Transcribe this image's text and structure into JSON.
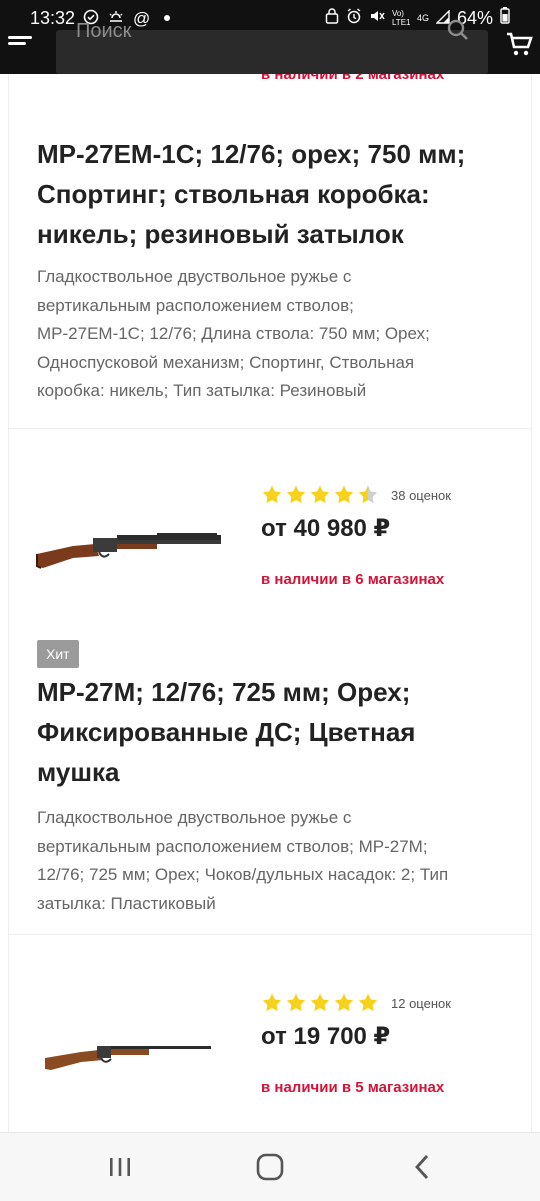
{
  "status_bar": {
    "time": "13:32",
    "battery": "64%",
    "network_label": "Vo) LTE1",
    "signal_label": "4G"
  },
  "header": {
    "search_placeholder": "Поиск",
    "accent_color": "#d2143a"
  },
  "products": [
    {
      "availability": "в наличии в 2 магазинах",
      "title_lines": [
        "МР-27ЕМ-1С; 12/76; орех; 750 мм;",
        "Спортинг; ствольная коробка:",
        "никель; резиновый затылок"
      ],
      "description_lines": [
        "Гладкоствольное двуствольное ружье с",
        "вертикальным расположением стволов;",
        "МР-27ЕМ-1С; 12/76; Длина ствола: 750 мм; Орех;",
        "Односпусковой механизм; Спортинг, Ствольная",
        "коробка: никель; Тип затылка: Резиновый"
      ]
    },
    {
      "rating": 4.5,
      "rating_count": "38 оценок",
      "price": "от 40 980 ₽",
      "availability": "в наличии в 6 магазинах",
      "badge": "Хит",
      "title_lines": [
        "МР-27М; 12/76; 725 мм; Орех;",
        "Фиксированные ДС; Цветная",
        "мушка"
      ],
      "description_lines": [
        "Гладкоствольное двуствольное ружье с",
        "вертикальным расположением стволов; МР-27М;",
        "12/76; 725 мм; Орех; Чоков/дульных насадок: 2; Тип",
        "затылка: Пластиковый"
      ]
    },
    {
      "rating": 5,
      "rating_count": "12 оценок",
      "price": "от 19 700 ₽",
      "availability": "в наличии в 5 магазинах"
    }
  ],
  "nav": {
    "recents_icon": "recents-icon",
    "home_icon": "home-icon",
    "back_icon": "back-icon"
  }
}
